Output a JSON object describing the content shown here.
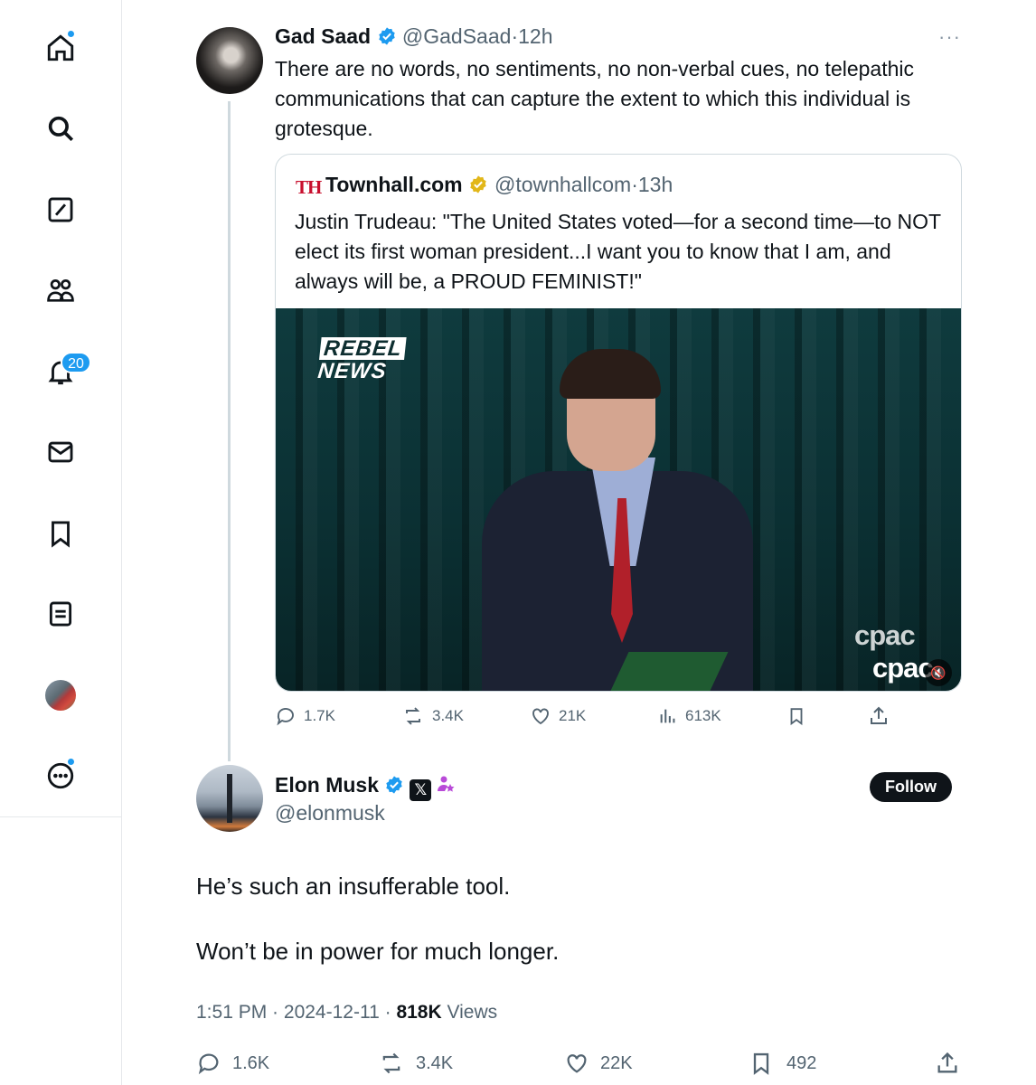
{
  "sidebar": {
    "notification_count": "20",
    "items": [
      "home",
      "explore",
      "grok",
      "communities",
      "notifications",
      "messages",
      "bookmarks",
      "lists",
      "profile",
      "more"
    ]
  },
  "tweet1": {
    "name": "Gad Saad",
    "handle": "@GadSaad",
    "time": "12h",
    "text": "There are no words, no sentiments, no non-verbal cues, no telepathic communications that can capture the extent to which this individual is grotesque.",
    "quote": {
      "logo": "TH",
      "name": "Townhall.com",
      "handle": "@townhallcom",
      "time": "13h",
      "text": "Justin Trudeau: \"The United States voted—for a second time—to NOT elect its first woman president...I want you to know that I am, and always will be, a PROUD FEMINIST!\"",
      "media": {
        "watermark_line1": "REBEL",
        "watermark_line2": "NEWS",
        "corner_logo": "cpac"
      }
    },
    "actions": {
      "replies": "1.7K",
      "reposts": "3.4K",
      "likes": "21K",
      "views": "613K"
    }
  },
  "tweet2": {
    "name": "Elon Musk",
    "handle": "@elonmusk",
    "follow_label": "Follow",
    "text_line1": "He’s such an insufferable tool.",
    "text_line2": "Won’t be in power for much longer.",
    "time": "1:51 PM",
    "date": "2024-12-11",
    "views_count": "818K",
    "views_label": "Views",
    "actions": {
      "replies": "1.6K",
      "reposts": "3.4K",
      "likes": "22K",
      "bookmarks": "492"
    }
  },
  "colors": {
    "accent": "#1d9bf0",
    "verified_gold": "#e2b719",
    "text_primary": "#0f1419",
    "text_secondary": "#536471"
  }
}
